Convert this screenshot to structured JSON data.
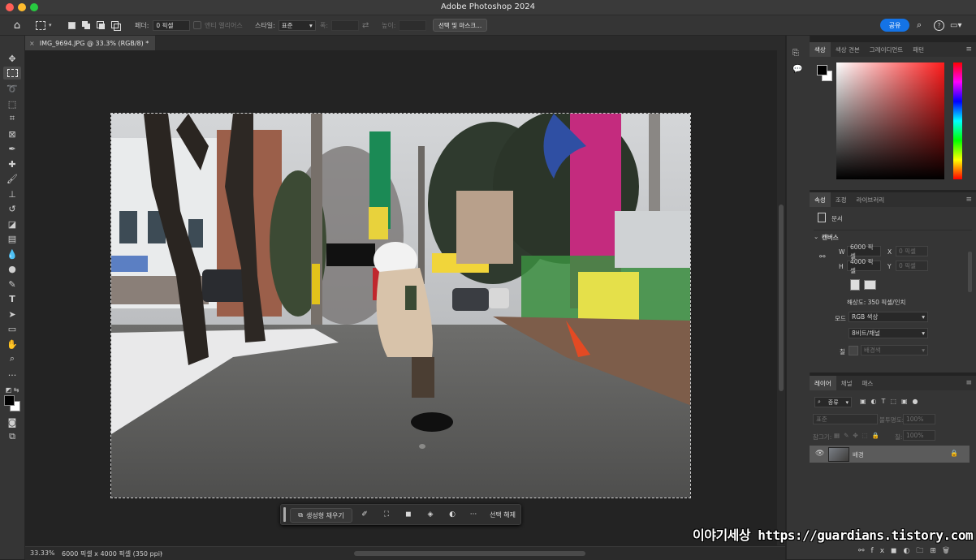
{
  "window": {
    "title": "Adobe Photoshop 2024"
  },
  "options_bar": {
    "feather_label": "페더:",
    "feather_value": "0 픽셀",
    "antialias_label": "앤티 앨리어스",
    "style_label": "스타일:",
    "style_value": "표준",
    "width_label": "폭:",
    "height_label": "높이:",
    "select_mask_button": "선택 및 마스크...",
    "share_button": "공유"
  },
  "document": {
    "tab_title": "IMG_9694.JPG @ 33.3% (RGB/8) *",
    "close_glyph": "×"
  },
  "contextual_taskbar": {
    "generative_fill": "생성형 채우기",
    "more": "···",
    "deselect": "선택 해제"
  },
  "status_bar": {
    "zoom": "33.33%",
    "info": "6000 픽셀 x 4000 픽셀 (350 ppi)",
    "arrow": "›"
  },
  "color_panel": {
    "tabs": [
      "색상",
      "색상 견본",
      "그레이디언트",
      "패턴"
    ],
    "active_tab": 0,
    "foreground": "#000000",
    "background": "#ffffff",
    "hue_color": "#ff1c1c"
  },
  "properties_panel": {
    "tabs": [
      "속성",
      "조정",
      "라이브러리"
    ],
    "doc_label": "문서",
    "canvas_section": "캔버스",
    "w_label": "W",
    "w_value": "6000 픽셀",
    "h_label": "H",
    "h_value": "4000 픽셀",
    "x_label": "X",
    "x_placeholder": "0 픽셀",
    "y_label": "Y",
    "y_placeholder": "0 픽셀",
    "resolution": "해상도: 350 픽셀/인치",
    "mode_label": "모드",
    "mode_value": "RGB 색상",
    "bits_value": "8비트/채널",
    "fill_label": "칠",
    "fill_value": "배경색"
  },
  "layers_panel": {
    "tabs": [
      "레이어",
      "채널",
      "패스"
    ],
    "filter_kind": "종류",
    "blend_mode": "표준",
    "opacity_label": "불투명도:",
    "opacity_value": "100%",
    "lock_label": "잠그기:",
    "fill_label": "칠:",
    "fill_value": "100%",
    "layers": [
      {
        "name": "배경",
        "visible": true,
        "locked": true
      }
    ]
  },
  "watermark": "이야기세상 https://guardians.tistory.com"
}
